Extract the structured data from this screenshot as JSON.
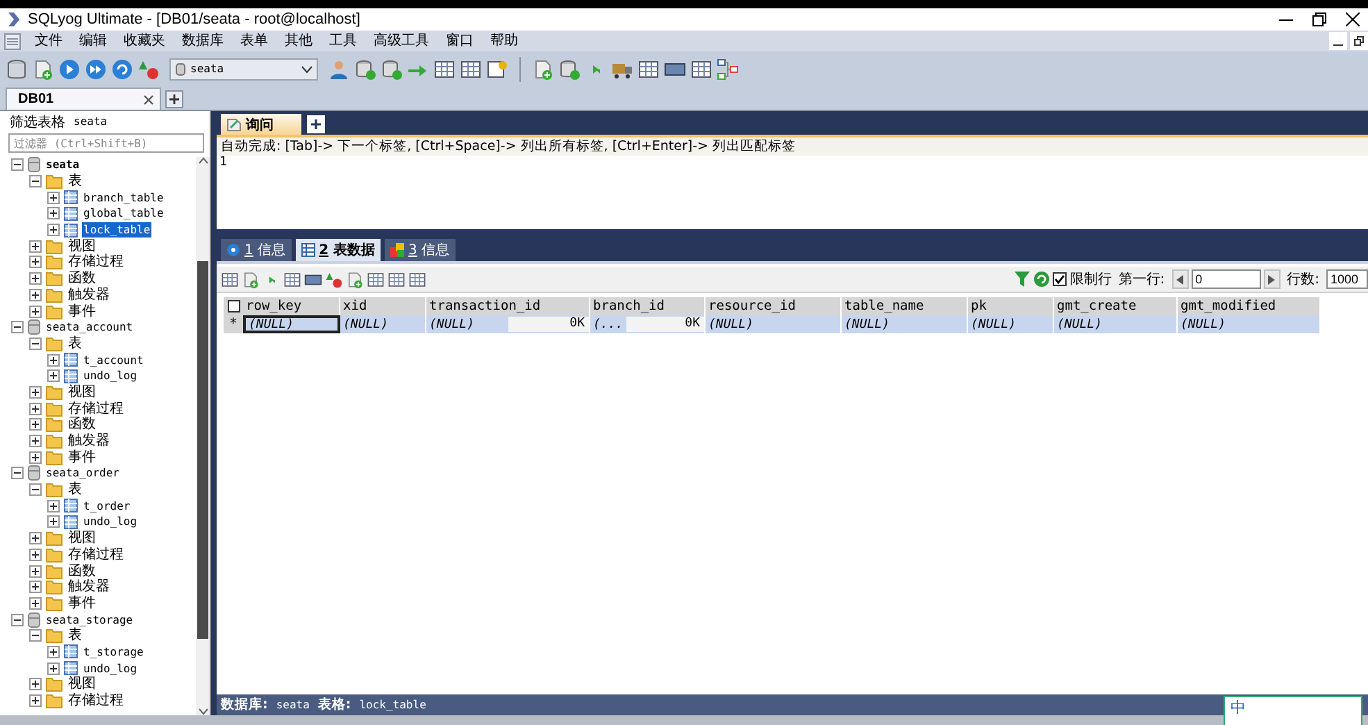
{
  "window": {
    "title": "SQLyog Ultimate - [DB01/seata - root@localhost]"
  },
  "menu": [
    "文件",
    "编辑",
    "收藏夹",
    "数据库",
    "表单",
    "其他",
    "工具",
    "高级工具",
    "窗口",
    "帮助"
  ],
  "toolbar": {
    "database_select": "seata"
  },
  "connection_tabs": [
    {
      "label": "DB01",
      "selected": true
    }
  ],
  "object_browser": {
    "filter_label": "筛选表格",
    "filter_db": "seata",
    "filter": {
      "placeholder": "过滤器 (Ctrl+Shift+B)"
    },
    "tree": [
      {
        "kind": "db",
        "label": "seata",
        "expanded": true,
        "active": true,
        "selected": false,
        "children": [
          {
            "kind": "folder",
            "label": "表",
            "expanded": true,
            "selected": false,
            "children": [
              {
                "kind": "table",
                "label": "branch_table",
                "expanded": false,
                "selected": false
              },
              {
                "kind": "table",
                "label": "global_table",
                "expanded": false,
                "selected": false
              },
              {
                "kind": "table",
                "label": "lock_table",
                "expanded": false,
                "selected": true
              }
            ]
          },
          {
            "kind": "folder",
            "label": "视图",
            "expanded": false,
            "selected": false
          },
          {
            "kind": "folder",
            "label": "存储过程",
            "expanded": false,
            "selected": false
          },
          {
            "kind": "folder",
            "label": "函数",
            "expanded": false,
            "selected": false
          },
          {
            "kind": "folder",
            "label": "触发器",
            "expanded": false,
            "selected": false
          },
          {
            "kind": "folder",
            "label": "事件",
            "expanded": false,
            "selected": false
          }
        ]
      },
      {
        "kind": "db",
        "label": "seata_account",
        "expanded": true,
        "active": false,
        "selected": false,
        "children": [
          {
            "kind": "folder",
            "label": "表",
            "expanded": true,
            "selected": false,
            "children": [
              {
                "kind": "table",
                "label": "t_account",
                "expanded": false,
                "selected": false
              },
              {
                "kind": "table",
                "label": "undo_log",
                "expanded": false,
                "selected": false
              }
            ]
          },
          {
            "kind": "folder",
            "label": "视图",
            "expanded": false,
            "selected": false
          },
          {
            "kind": "folder",
            "label": "存储过程",
            "expanded": false,
            "selected": false
          },
          {
            "kind": "folder",
            "label": "函数",
            "expanded": false,
            "selected": false
          },
          {
            "kind": "folder",
            "label": "触发器",
            "expanded": false,
            "selected": false
          },
          {
            "kind": "folder",
            "label": "事件",
            "expanded": false,
            "selected": false
          }
        ]
      },
      {
        "kind": "db",
        "label": "seata_order",
        "expanded": true,
        "active": false,
        "selected": false,
        "children": [
          {
            "kind": "folder",
            "label": "表",
            "expanded": true,
            "selected": false,
            "children": [
              {
                "kind": "table",
                "label": "t_order",
                "expanded": false,
                "selected": false
              },
              {
                "kind": "table",
                "label": "undo_log",
                "expanded": false,
                "selected": false
              }
            ]
          },
          {
            "kind": "folder",
            "label": "视图",
            "expanded": false,
            "selected": false
          },
          {
            "kind": "folder",
            "label": "存储过程",
            "expanded": false,
            "selected": false
          },
          {
            "kind": "folder",
            "label": "函数",
            "expanded": false,
            "selected": false
          },
          {
            "kind": "folder",
            "label": "触发器",
            "expanded": false,
            "selected": false
          },
          {
            "kind": "folder",
            "label": "事件",
            "expanded": false,
            "selected": false
          }
        ]
      },
      {
        "kind": "db",
        "label": "seata_storage",
        "expanded": true,
        "active": false,
        "selected": false,
        "children": [
          {
            "kind": "folder",
            "label": "表",
            "expanded": true,
            "selected": false,
            "children": [
              {
                "kind": "table",
                "label": "t_storage",
                "expanded": false,
                "selected": false
              },
              {
                "kind": "table",
                "label": "undo_log",
                "expanded": false,
                "selected": false
              }
            ]
          },
          {
            "kind": "folder",
            "label": "视图",
            "expanded": false,
            "selected": false
          },
          {
            "kind": "folder",
            "label": "存储过程",
            "expanded": false,
            "selected": false
          }
        ]
      }
    ]
  },
  "query_tabs": [
    {
      "label": "询问",
      "selected": true
    }
  ],
  "autocomplete_hint": "自动完成: [Tab]-> 下一个标签, [Ctrl+Space]-> 列出所有标签, [Ctrl+Enter]-> 列出匹配标签",
  "editor": {
    "line_numbers": [
      "1"
    ]
  },
  "result_tabs": [
    {
      "number": "1",
      "label": "信息",
      "selected": false
    },
    {
      "number": "2",
      "label": "表数据",
      "selected": true
    },
    {
      "number": "3",
      "label": "信息",
      "selected": false
    }
  ],
  "result_toolbar": {
    "limit_rows": {
      "label": "限制行",
      "checked": true
    },
    "first_row_label": "第一行:",
    "first_row": "0",
    "row_count_label": "行数:",
    "row_count": "1000"
  },
  "grid": {
    "columns": [
      "row_key",
      "xid",
      "transaction_id",
      "branch_id",
      "resource_id",
      "table_name",
      "pk",
      "gmt_create",
      "gmt_modified"
    ],
    "rows": [
      {
        "marker": "*",
        "cells": [
          {
            "text": "(NULL)",
            "focused": true
          },
          {
            "text": "(NULL)"
          },
          {
            "text": "(NULL)",
            "size": "0K"
          },
          {
            "text": "(...",
            "size": "0K"
          },
          {
            "text": "(NULL)"
          },
          {
            "text": "(NULL)"
          },
          {
            "text": "(NULL)"
          },
          {
            "text": "(NULL)"
          },
          {
            "text": "(NULL)"
          }
        ]
      }
    ]
  },
  "status_bar": [
    {
      "label": "数据库:",
      "value": "seata"
    },
    {
      "label": "表格:",
      "value": "lock_table"
    }
  ],
  "ime": {
    "mode": "中"
  }
}
